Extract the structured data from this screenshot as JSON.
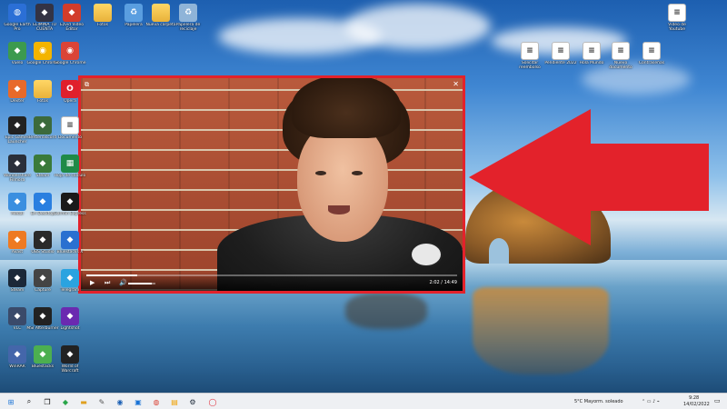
{
  "desktop_icons": [
    {
      "label": "Google Earth Pro",
      "icon": "globe-icon",
      "color": "#2b6fd6"
    },
    {
      "label": "ELIMINA TU CUENTA",
      "icon": "app-icon",
      "color": "#333344"
    },
    {
      "label": "Ezvid Video Editor",
      "icon": "app-icon",
      "color": "#d23c2b"
    },
    {
      "label": "Fotos",
      "icon": "folder-icon",
      "color": "#f0c040"
    },
    {
      "label": "Papelera",
      "icon": "recycle-bin-icon",
      "color": "#5a9ee0"
    },
    {
      "label": "Nueva carpeta",
      "icon": "folder-icon",
      "color": "#f0c040"
    },
    {
      "label": "Papelera de reciclaje",
      "icon": "recycle-bin-icon",
      "color": "#8fb4d8"
    },
    {
      "label": "Vídeo de Youtube",
      "icon": "document-icon",
      "color": "#ffffff"
    },
    {
      "label": "Solicitar reembolso",
      "icon": "document-icon",
      "color": "#ffffff"
    },
    {
      "label": "Pendiente 2022",
      "icon": "document-icon",
      "color": "#ffffff"
    },
    {
      "label": "Hola Mundo",
      "icon": "document-icon",
      "color": "#ffffff"
    },
    {
      "label": "Nuevo documento",
      "icon": "document-icon",
      "color": "#ffffff"
    },
    {
      "label": "Contraseñas",
      "icon": "document-icon",
      "color": "#ffffff"
    }
  ],
  "left_column_icons": [
    {
      "label": "Vuelo",
      "icon": "app-icon",
      "color": "#3c9a4e"
    },
    {
      "label": "Dexter",
      "icon": "app-icon",
      "color": "#e86a2b"
    },
    {
      "label": "Epic Games Launcher",
      "icon": "app-icon",
      "color": "#222222"
    },
    {
      "label": "Wondershare Filmora",
      "icon": "app-icon",
      "color": "#2a2f3a"
    },
    {
      "label": "Medal",
      "icon": "app-icon",
      "color": "#3b8fe0"
    },
    {
      "label": "Avast",
      "icon": "app-icon",
      "color": "#ee7a22"
    },
    {
      "label": "Steam",
      "icon": "app-icon",
      "color": "#1b2838"
    },
    {
      "label": "VLC",
      "icon": "app-icon",
      "color": "#3a4a6a"
    },
    {
      "label": "WinRAR",
      "icon": "app-icon",
      "color": "#4466aa"
    }
  ],
  "second_column_icons": [
    {
      "label": "Google Chrome",
      "icon": "chrome-icon",
      "color": "#f4b400"
    },
    {
      "label": "Fotos",
      "icon": "folder-icon",
      "color": "#f0c040"
    },
    {
      "label": "Betterdiscord",
      "icon": "app-icon",
      "color": "#3c6a3c"
    },
    {
      "label": "Steam",
      "icon": "app-icon",
      "color": "#3a7a3a"
    },
    {
      "label": "EA Desktop",
      "icon": "app-icon",
      "color": "#2a7fe0"
    },
    {
      "label": "OBS Studio",
      "icon": "app-icon",
      "color": "#2a2a2a"
    },
    {
      "label": "Capture",
      "icon": "app-icon",
      "color": "#444444"
    },
    {
      "label": "MSI Afterburner",
      "icon": "app-icon",
      "color": "#222222"
    },
    {
      "label": "Bluestacks",
      "icon": "app-icon",
      "color": "#4caf50"
    }
  ],
  "third_column_icons": [
    {
      "label": "Google Chrome",
      "icon": "chrome-icon",
      "color": "#db4437"
    },
    {
      "label": "Opera",
      "icon": "opera-icon",
      "color": "#e0202c"
    },
    {
      "label": "Documento",
      "icon": "document-icon",
      "color": "#ffffff"
    },
    {
      "label": "Hoja de cálculo",
      "icon": "spreadsheet-icon",
      "color": "#1f8a47"
    },
    {
      "label": "Garmin Express",
      "icon": "app-icon",
      "color": "#1a1a1a"
    },
    {
      "label": "Bluestacks X",
      "icon": "app-icon",
      "color": "#2a70d0"
    },
    {
      "label": "Telegram",
      "icon": "app-icon",
      "color": "#2aa3e0"
    },
    {
      "label": "Lightshot",
      "icon": "app-icon",
      "color": "#6a2ab0"
    },
    {
      "label": "World of Warcraft",
      "icon": "app-icon",
      "color": "#222222"
    }
  ],
  "player": {
    "time": "2:02 / 14:49",
    "progress": 0.137,
    "volume": 0.85
  },
  "taskbar": {
    "weather": "5°C  Mayorm. soleado",
    "time": "9:28",
    "date": "14/02/2022"
  }
}
